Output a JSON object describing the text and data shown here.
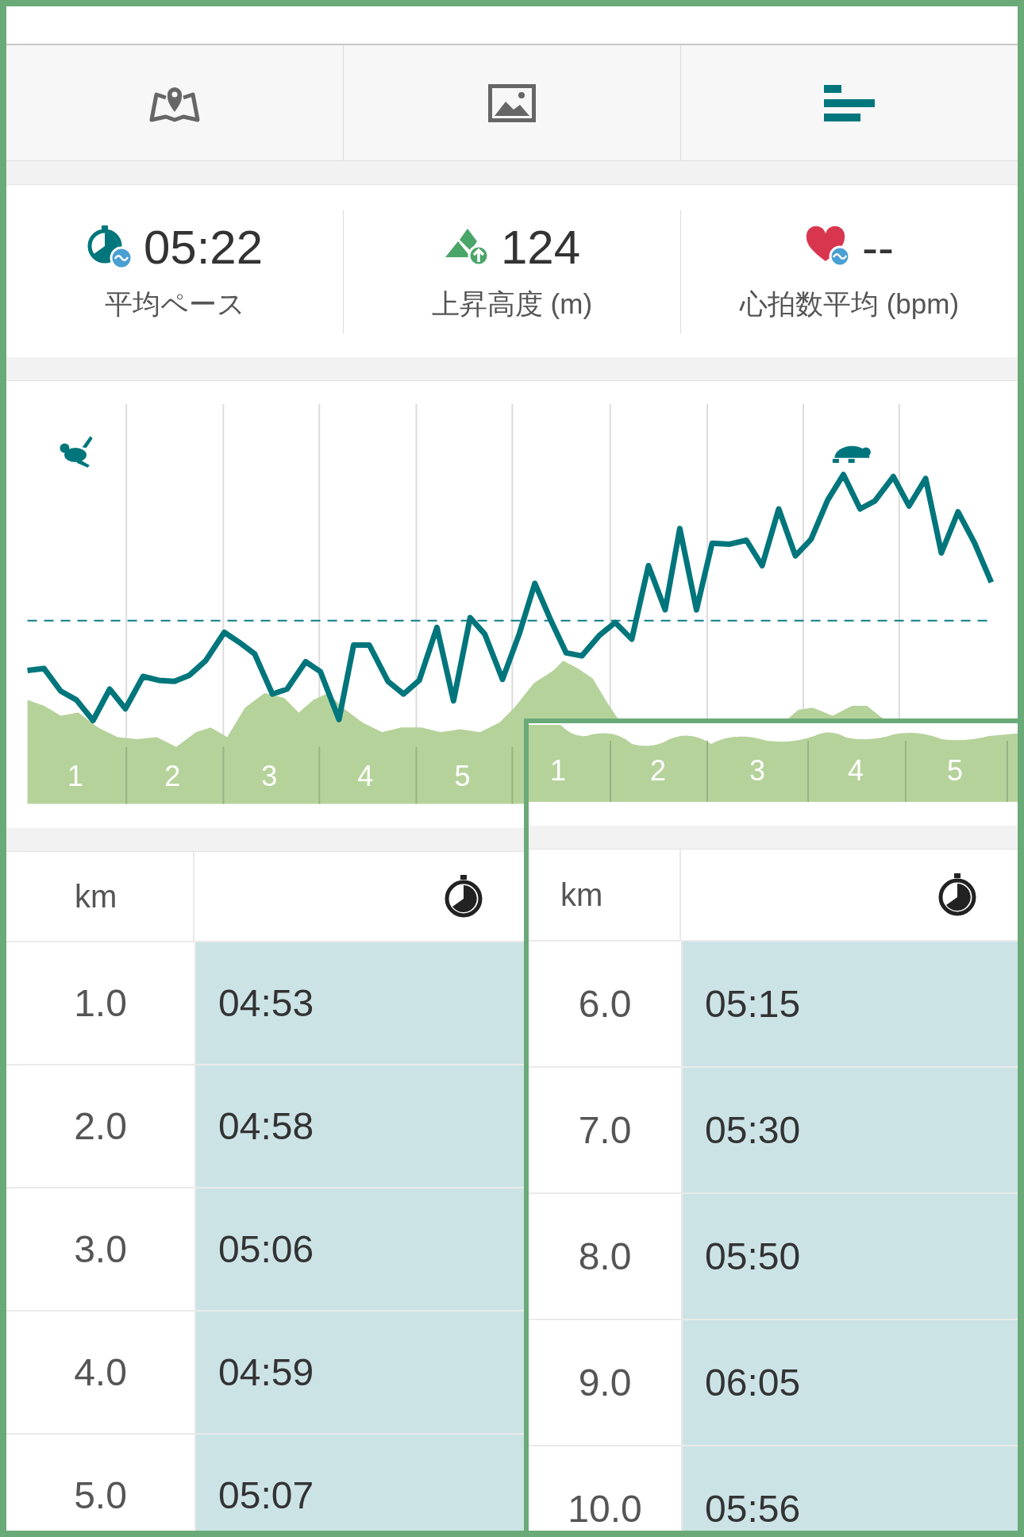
{
  "tabs": [
    {
      "kind": "map",
      "selected": false
    },
    {
      "kind": "photo",
      "selected": false
    },
    {
      "kind": "splits",
      "selected": true
    }
  ],
  "stats": [
    {
      "kind": "pace",
      "value": "05:22",
      "label": "平均ペース"
    },
    {
      "kind": "elevation",
      "value": "124",
      "label": "上昇高度 (m)"
    },
    {
      "kind": "heart",
      "value": "--",
      "label": "心拍数平均 (bpm)"
    }
  ],
  "pace_chart": {
    "segment_labels": [
      "1",
      "2",
      "3",
      "4",
      "5"
    ]
  },
  "splits": {
    "km_header": "km",
    "rows": [
      {
        "km": "1.0",
        "time": "04:53"
      },
      {
        "km": "2.0",
        "time": "04:58"
      },
      {
        "km": "3.0",
        "time": "05:06"
      },
      {
        "km": "4.0",
        "time": "04:59"
      },
      {
        "km": "5.0",
        "time": "05:07"
      }
    ]
  },
  "overlay": {
    "segment_labels": [
      "1",
      "2",
      "3",
      "4",
      "5"
    ],
    "splits": {
      "km_header": "km",
      "rows": [
        {
          "km": "6.0",
          "time": "05:15"
        },
        {
          "km": "7.0",
          "time": "05:30"
        },
        {
          "km": "8.0",
          "time": "05:50"
        },
        {
          "km": "9.0",
          "time": "06:05"
        },
        {
          "km": "10.0",
          "time": "05:56"
        }
      ]
    }
  }
}
